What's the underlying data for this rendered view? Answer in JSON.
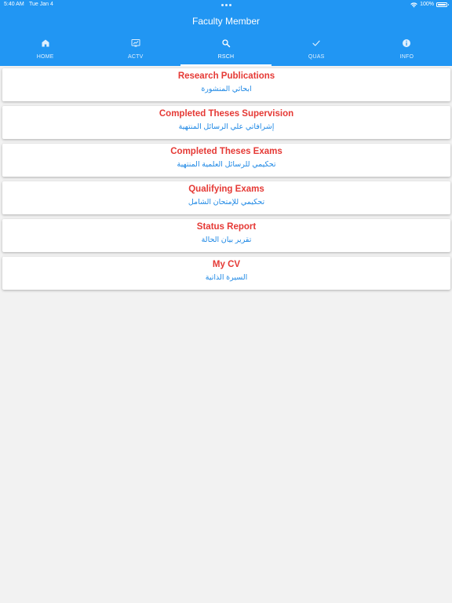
{
  "status_bar": {
    "time": "5:40 AM",
    "date": "Tue Jan 4",
    "battery_percent": "100%",
    "battery_level": 1.0,
    "wifi_icon": "wifi-icon",
    "battery_icon": "battery-icon"
  },
  "header": {
    "title": "Faculty Member",
    "background_color": "#2196f3"
  },
  "tabs": [
    {
      "label": "HOME",
      "icon": "home-icon",
      "active": false
    },
    {
      "label": "ACTV",
      "icon": "presentation-icon",
      "active": false
    },
    {
      "label": "RSCH",
      "icon": "search-icon",
      "active": true
    },
    {
      "label": "QUAS",
      "icon": "checkmark-icon",
      "active": false
    },
    {
      "label": "INFO",
      "icon": "info-icon",
      "active": false
    }
  ],
  "menu_items": [
    {
      "title": "Research Publications",
      "subtitle": "ابحاثي المنشورة"
    },
    {
      "title": "Completed Theses Supervision",
      "subtitle": "إشرافاتي علي الرسائل المنتهية"
    },
    {
      "title": "Completed Theses Exams",
      "subtitle": "تحكيمي للرسائل العلمية المنتهية"
    },
    {
      "title": "Qualifying Exams",
      "subtitle": "تحكيمي للإمتحان الشامل"
    },
    {
      "title": "Status Report",
      "subtitle": "تقرير بيان الحالة"
    },
    {
      "title": "My CV",
      "subtitle": "السيرة الذاتية"
    }
  ],
  "colors": {
    "title_red": "#e53935",
    "subtitle_blue": "#1e88e5",
    "page_background": "#f2f2f2"
  }
}
